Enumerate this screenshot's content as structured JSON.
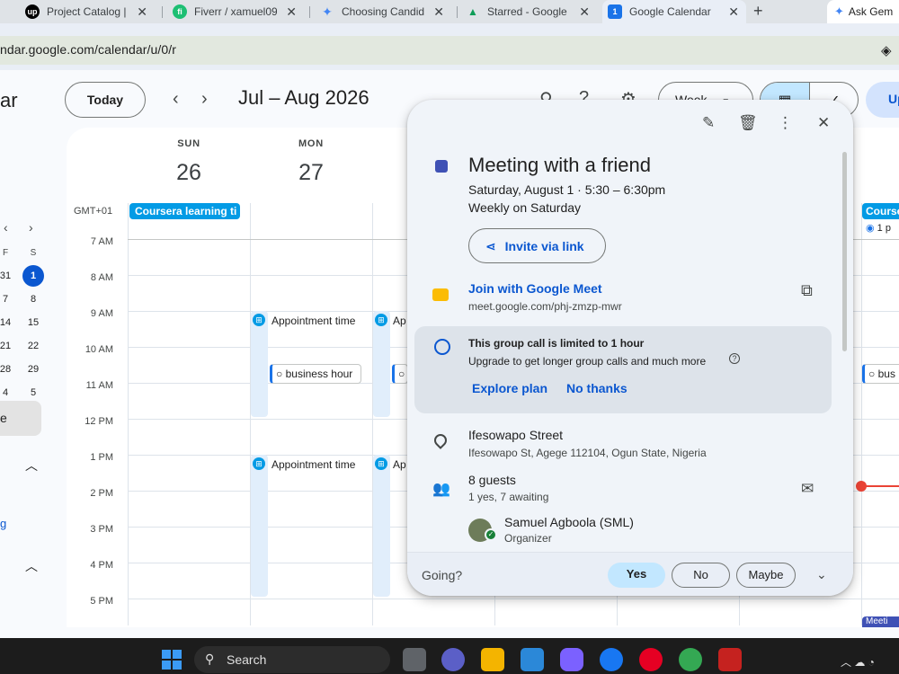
{
  "browser": {
    "tabs": [
      {
        "label": "Project Catalog | ",
        "favicon": "upwork-icon",
        "color": "#000000",
        "glyph": "up"
      },
      {
        "label": "Fiverr / xamuel09",
        "favicon": "fiverr-icon",
        "color": "#1dbf73",
        "glyph": "fi"
      },
      {
        "label": "Choosing Candid",
        "favicon": "gemini-icon",
        "color": "#4285f4",
        "glyph": "✦"
      },
      {
        "label": "Starred - Google",
        "favicon": "drive-icon",
        "color": "#0f9d58",
        "glyph": "▲"
      },
      {
        "label": "Google Calendar",
        "favicon": "calendar-icon",
        "color": "#1a73e8",
        "glyph": "1"
      }
    ],
    "new_tab": "+",
    "gemini_button": "Ask Gem",
    "url": "ndar.google.com/calendar/u/0/r"
  },
  "header": {
    "app_title": "ar",
    "today": "Today",
    "prev": "‹",
    "next": "›",
    "range": "Jul – Aug 2026",
    "view": "Week",
    "view_caret": "▾",
    "upgrade": "Up"
  },
  "mini_calendar": {
    "prev": "‹",
    "next": "›",
    "headers": [
      "F",
      "S"
    ],
    "rows": [
      [
        "31",
        "1"
      ],
      [
        "7",
        "8"
      ],
      [
        "14",
        "15"
      ],
      [
        "21",
        "22"
      ],
      [
        "28",
        "29"
      ],
      [
        "4",
        "5"
      ]
    ],
    "today": "1"
  },
  "sidebar": {
    "selected_label": "e",
    "link_label": "g"
  },
  "grid": {
    "days": [
      {
        "dow": "SUN",
        "dom": "26"
      },
      {
        "dow": "MON",
        "dom": "27"
      }
    ],
    "timezone": "GMT+01",
    "allday_event": "Coursera learning ti",
    "hours": [
      "7 AM",
      "8 AM",
      "9 AM",
      "10 AM",
      "11 AM",
      "12 PM",
      "1 PM",
      "2 PM",
      "3 PM",
      "4 PM",
      "5 PM"
    ],
    "appointment_label": "Appointment time",
    "appointment_short": "Ap",
    "task_label": "business hour",
    "task_edge_label": "bus",
    "edge_event": "Course",
    "edge_sub": "1 p",
    "edge_bottom": "Meeti"
  },
  "event_card": {
    "title": "Meeting with a friend",
    "when": "Saturday, August 1  ·  5:30 – 6:30pm",
    "repeat": "Weekly on Saturday",
    "invite": "Invite via link",
    "meet_link": "Join with Google Meet",
    "meet_url": "meet.google.com/phj-zmzp-mwr",
    "promo_heading": "This group call is limited to 1 hour",
    "promo_sub": "Upgrade to get longer group calls and much more",
    "explore": "Explore plan",
    "no_thanks": "No thanks",
    "location": "Ifesowapo Street",
    "address": "Ifesowapo St, Agege 112104, Ogun State, Nigeria",
    "guests": "8 guests",
    "rsvp": "1 yes, 7 awaiting",
    "organizer_name": "Samuel Agboola (SML)",
    "organizer_role": "Organizer",
    "going": "Going?",
    "yes": "Yes",
    "no": "No",
    "maybe": "Maybe",
    "event_color": "#3f51b5"
  },
  "taskbar": {
    "search": "Search"
  }
}
